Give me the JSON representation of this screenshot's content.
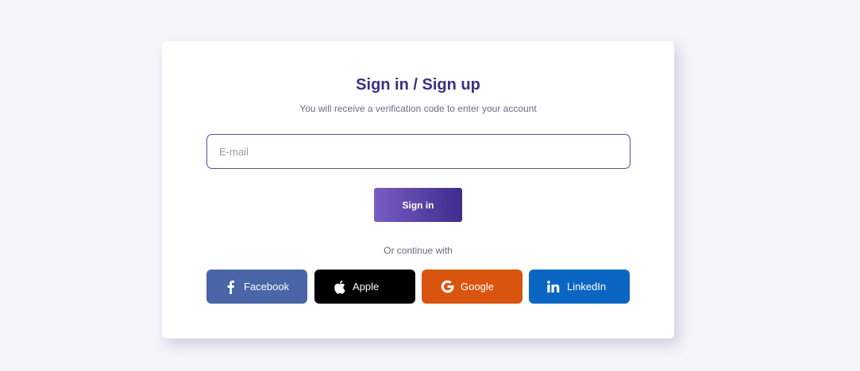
{
  "card": {
    "title": "Sign in / Sign up",
    "subtitle": "You will receive a verification code to enter your account"
  },
  "form": {
    "email_placeholder": "E-mail",
    "email_value": "",
    "submit_label": "Sign in"
  },
  "divider_text": "Or continue with",
  "social": [
    {
      "label": "Facebook",
      "icon": "facebook-icon",
      "color": "#4a66a8"
    },
    {
      "label": "Apple",
      "icon": "apple-icon",
      "color": "#000000"
    },
    {
      "label": "Google",
      "icon": "google-icon",
      "color": "#d9540f"
    },
    {
      "label": "LinkedIn",
      "icon": "linkedin-icon",
      "color": "#0a66c2"
    }
  ],
  "colors": {
    "background": "#f4f4f9",
    "title": "#3d2f86",
    "accent_gradient_start": "#7a5cc4",
    "accent_gradient_end": "#3e2c8c"
  }
}
